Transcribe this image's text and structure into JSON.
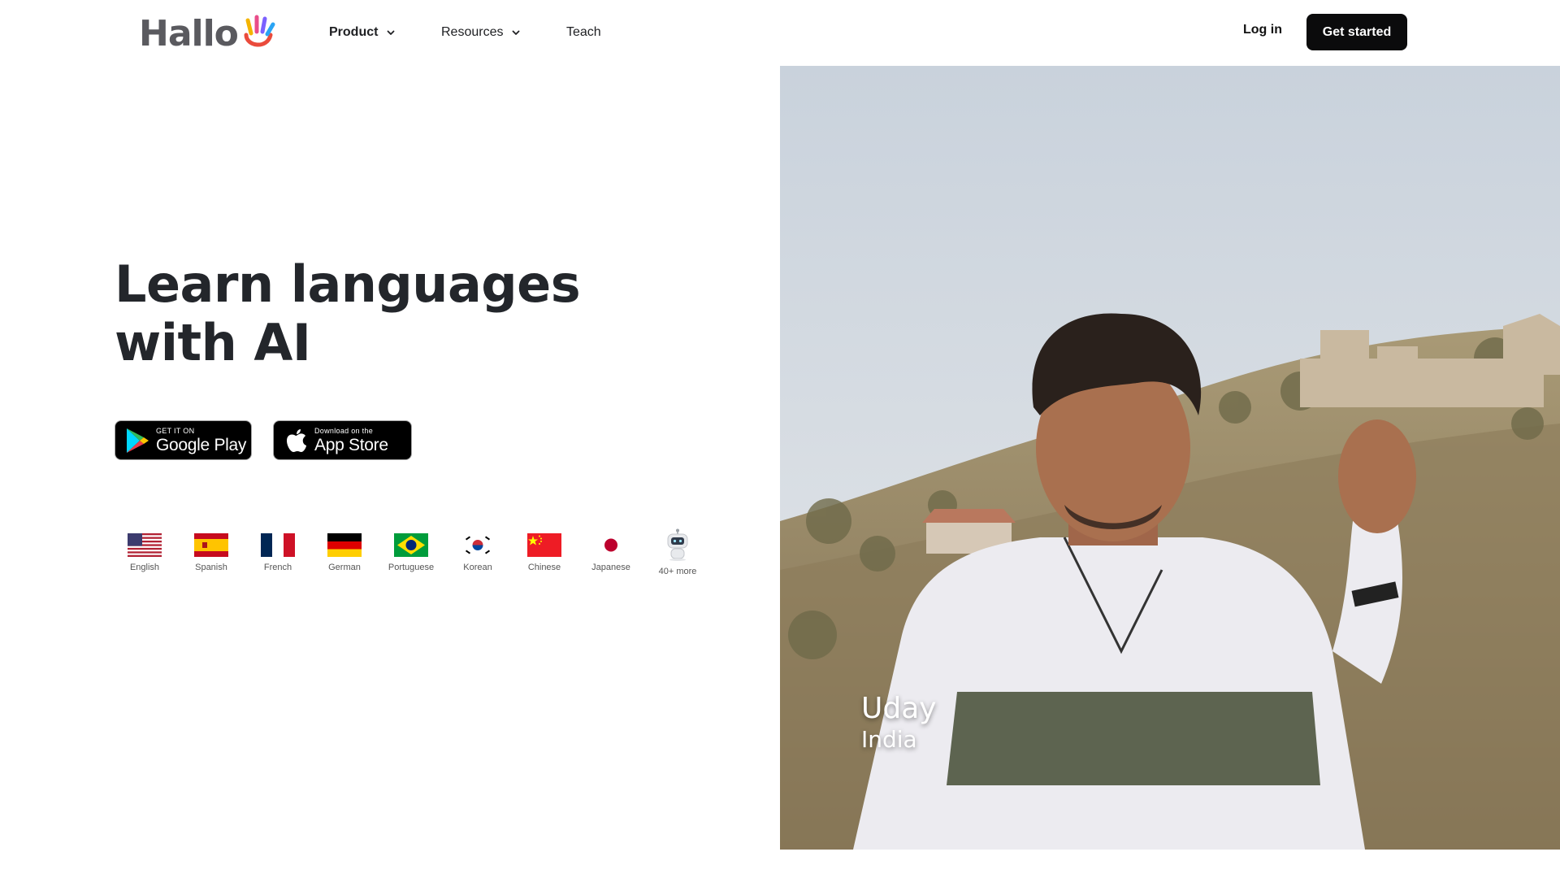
{
  "brand": {
    "name": "Hallo"
  },
  "nav": {
    "product": "Product",
    "resources": "Resources",
    "teach": "Teach"
  },
  "auth": {
    "login": "Log in",
    "get_started": "Get started"
  },
  "hero": {
    "headline_line1": "Learn languages",
    "headline_line2": "with AI",
    "google_play": {
      "small": "GET IT ON",
      "big": "Google Play"
    },
    "app_store": {
      "small": "Download on the",
      "big": "App Store"
    },
    "languages": [
      {
        "label": "English",
        "flag": "us-flag"
      },
      {
        "label": "Spanish",
        "flag": "spain-flag"
      },
      {
        "label": "French",
        "flag": "france-flag"
      },
      {
        "label": "German",
        "flag": "germany-flag"
      },
      {
        "label": "Portuguese",
        "flag": "brazil-flag"
      },
      {
        "label": "Korean",
        "flag": "korea-flag"
      },
      {
        "label": "Chinese",
        "flag": "china-flag"
      },
      {
        "label": "Japanese",
        "flag": "japan-flag"
      },
      {
        "label": "40+ more",
        "flag": "robot-icon"
      }
    ],
    "video": {
      "person_name": "Uday",
      "person_country": "India"
    }
  },
  "colors": {
    "primary_button": "#0b0b0c",
    "headline": "#23262b",
    "logo_text": "#5a5a5f"
  }
}
